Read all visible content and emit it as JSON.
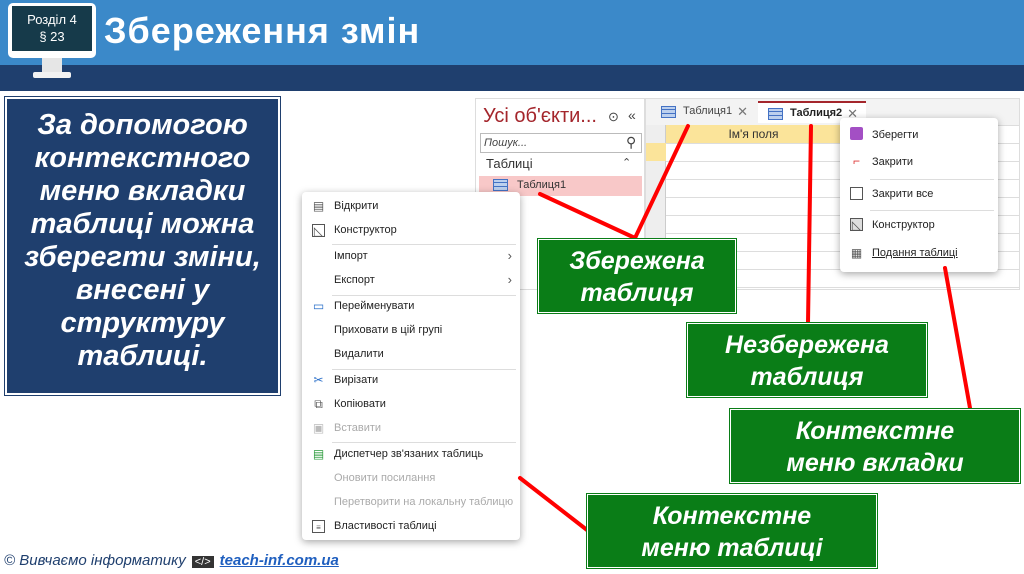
{
  "header": {
    "section": "Розділ 4",
    "paragraph": "§ 23",
    "title": "Збереження змін"
  },
  "description": "За допомогою контекстного меню вкладки таблиці можна зберегти зміни, внесені у структуру таблиці.",
  "nav_pane": {
    "title": "Усі об'єкти...",
    "search_placeholder": "Пошук...",
    "group": "Таблиці",
    "item": "Таблиця1"
  },
  "tabs": [
    {
      "label": "Таблиця1"
    },
    {
      "label": "Таблиця2"
    }
  ],
  "grid": {
    "field_header": "Ім'я поля"
  },
  "tab_menu": [
    {
      "label": "Зберегти",
      "icon": "save-icon"
    },
    {
      "label": "Закрити",
      "icon": "close-icon"
    },
    {
      "label": "Закрити все",
      "icon": "folder-icon"
    },
    {
      "label": "Конструктор",
      "icon": "design-icon"
    },
    {
      "label": "Подання таблиці",
      "icon": "table-view-icon"
    }
  ],
  "table_menu": [
    {
      "label": "Відкрити",
      "icon": "open-icon"
    },
    {
      "label": "Конструктор",
      "icon": "design-icon"
    },
    {
      "label": "Імпорт"
    },
    {
      "label": "Експорт"
    },
    {
      "label": "Перейменувати",
      "icon": "rename-icon"
    },
    {
      "label": "Приховати в цій групі"
    },
    {
      "label": "Видалити"
    },
    {
      "label": "Вирізати",
      "icon": "cut-icon"
    },
    {
      "label": "Копіювати",
      "icon": "copy-icon"
    },
    {
      "label": "Вставити",
      "icon": "paste-icon",
      "disabled": true
    },
    {
      "label": "Диспетчер зв'язаних таблиць",
      "icon": "linked-tables-icon"
    },
    {
      "label": "Оновити посилання",
      "disabled": true
    },
    {
      "label": "Перетворити на локальну таблицю",
      "disabled": true
    },
    {
      "label": "Властивості таблиці",
      "icon": "properties-icon"
    }
  ],
  "callouts": {
    "saved": "Збережена таблиця",
    "unsaved": "Незбережена таблиця",
    "tab_menu": "Контекстне меню вкладки",
    "table_menu": "Контекстне меню таблиці"
  },
  "footer": {
    "copyright": "© Вивчаємо інформатику",
    "code_icon": "</>",
    "link": "teach-inf.com.ua"
  },
  "colors": {
    "header": "#3b89c9",
    "navy": "#1f3f6e",
    "green": "#0a7d17",
    "red": "#ff0000"
  }
}
